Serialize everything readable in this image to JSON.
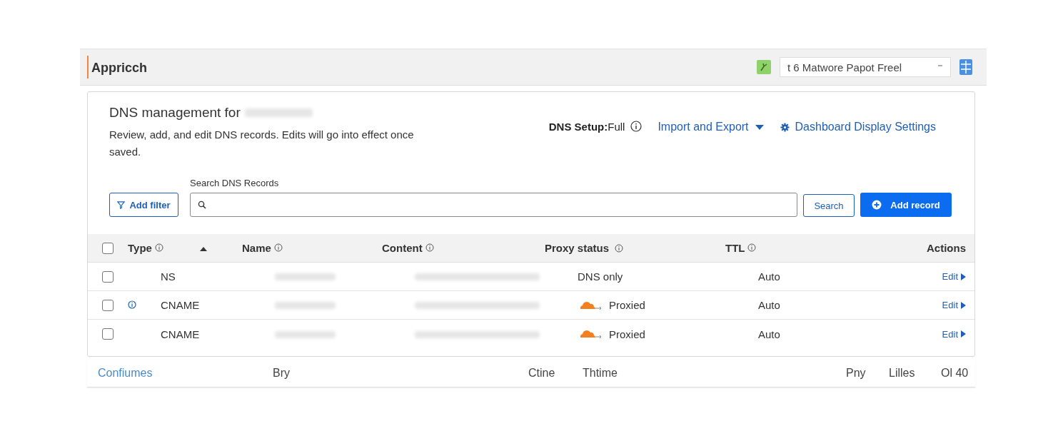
{
  "top_bar": {
    "title": "Appricch",
    "plan_select": {
      "value": "t 6  Matwore Papot Freel"
    }
  },
  "header": {
    "title": "DNS management for",
    "description": "Review, add, and edit DNS records. Edits will go into effect once saved.",
    "setup_label": "DNS Setup:",
    "setup_value": "Full",
    "import_export": "Import and Export",
    "display_settings": "Dashboard Display Settings"
  },
  "toolbar": {
    "add_filter": "Add filter",
    "search_label": "Search DNS Records",
    "search_button": "Search",
    "add_record": "Add record"
  },
  "table": {
    "select_all": {
      "checked": false
    },
    "columns": [
      "Type",
      "Name",
      "Content",
      "Proxy status",
      "TTL",
      "Actions"
    ],
    "rows": [
      {
        "checked": false,
        "info": false,
        "type": "NS",
        "proxied": false,
        "proxy_status": "DNS only",
        "ttl": "Auto",
        "action": "Edit"
      },
      {
        "checked": false,
        "info": true,
        "type": "CNAME",
        "proxied": true,
        "proxy_status": "Proxied",
        "ttl": "Auto",
        "action": "Edit"
      },
      {
        "checked": false,
        "info": false,
        "type": "CNAME",
        "proxied": true,
        "proxy_status": "Proxied",
        "ttl": "Auto",
        "action": "Edit"
      }
    ]
  },
  "footer": [
    "Confiumes",
    "Bry",
    "Ctine",
    "Thtime",
    "Pny",
    "Lilles",
    "Ol 40"
  ]
}
